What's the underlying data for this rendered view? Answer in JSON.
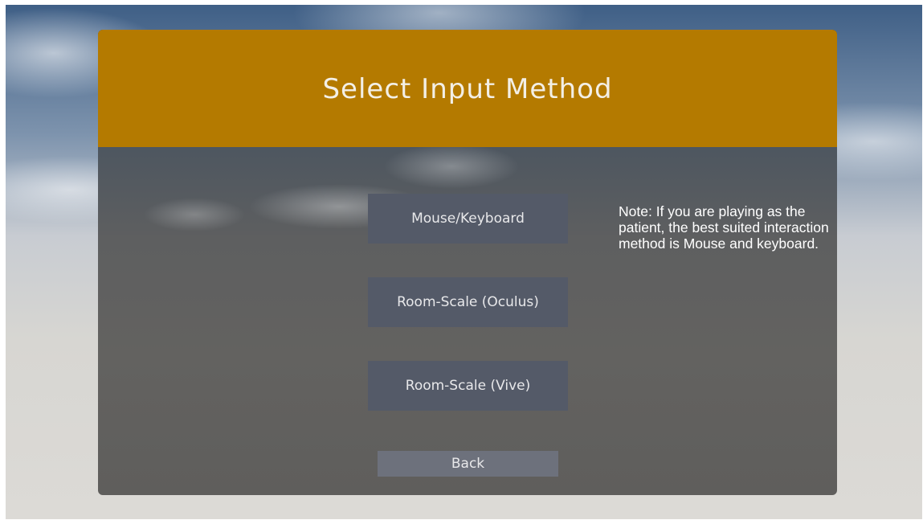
{
  "menu": {
    "title": "Select Input Method",
    "buttons": {
      "mouse_keyboard": "Mouse/Keyboard",
      "oculus": "Room-Scale (Oculus)",
      "vive": "Room-Scale (Vive)",
      "back": "Back"
    },
    "note": "Note: If you are playing as the patient, the best suited interaction method is Mouse and keyboard."
  },
  "colors": {
    "header": "#b47a00",
    "button": "#545a68",
    "back_button": "#6d717c",
    "title_text": "#f3efe6"
  }
}
